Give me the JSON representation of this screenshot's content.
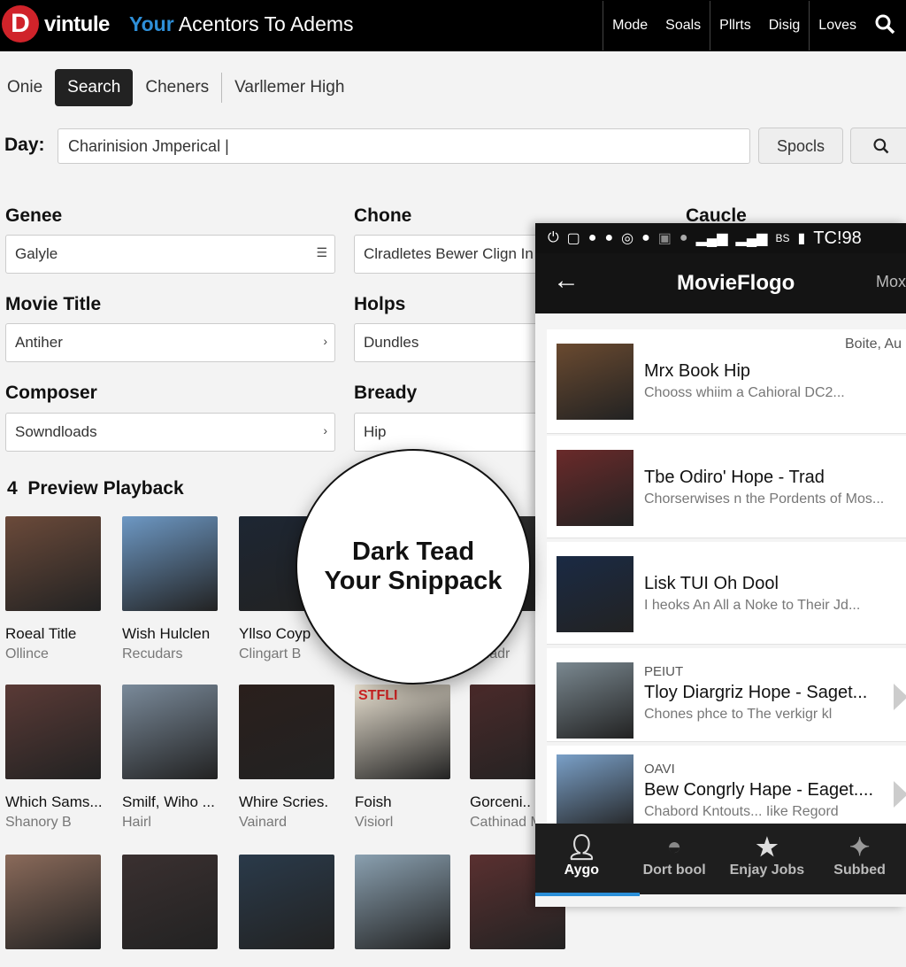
{
  "header": {
    "logo_letter": "D",
    "brand": "vintule",
    "tagline_accent": "Your",
    "tagline": "Acentors To Adems",
    "nav": [
      "Mode",
      "Soals",
      "Pllrts",
      "Disig",
      "Loves"
    ],
    "search_icon": "search-icon"
  },
  "tabs": [
    {
      "label": "Onie"
    },
    {
      "label": "Search",
      "active": true
    },
    {
      "label": "Cheners"
    },
    {
      "label": "Varllemer High"
    }
  ],
  "day": {
    "label": "Day:",
    "value": "Charinision Jmperical |",
    "button": "Spocls"
  },
  "form": {
    "genre": {
      "label": "Genee",
      "value": "Galyle"
    },
    "chone": {
      "label": "Chone",
      "value": "Clradletes Bewer Clign In"
    },
    "cauclе": {
      "label": "Caucle"
    },
    "movie_title": {
      "label": "Movie Title",
      "value": "Antiher"
    },
    "holps": {
      "label": "Holps",
      "value": "Dundles"
    },
    "composer": {
      "label": "Composer",
      "value": "Sowndloads"
    },
    "bready": {
      "label": "Bready",
      "value": "Hip"
    }
  },
  "section": {
    "count": "4",
    "title": "Preview Playback"
  },
  "grid": [
    {
      "title": "Roeal Title",
      "sub": "Ollince",
      "color": "#6b4a3a"
    },
    {
      "title": "Wish Hulclen",
      "sub": "Recudars",
      "color": "#6d98c4"
    },
    {
      "title": "Yllso Coyp",
      "sub": "Clingart B",
      "color": "#1d2633"
    },
    {
      "title": "",
      "sub": "",
      "color": "#444"
    },
    {
      "title": "...tin",
      "sub": "...riadr",
      "color": "#333"
    },
    {
      "title": "Which Sams...",
      "sub": "Shanory B",
      "color": "#5a3a36"
    },
    {
      "title": "Smilf, Wiho ...",
      "sub": "Hairl",
      "color": "#7a8a9a"
    },
    {
      "title": "Whire Scries.",
      "sub": "Vainard",
      "color": "#2a1f1c"
    },
    {
      "title": "Foish",
      "sub": "Visiorl",
      "color": "#e8e0d0",
      "poster_text": "STFLI"
    },
    {
      "title": "Gorceni..",
      "sub": "Cathinad M",
      "color": "#4a2a2a"
    },
    {
      "title": "",
      "sub": "",
      "color": "#8a6a5a"
    },
    {
      "title": "",
      "sub": "",
      "color": "#3a3030"
    },
    {
      "title": "",
      "sub": "",
      "color": "#2a3a4a"
    },
    {
      "title": "",
      "sub": "",
      "color": "#8aa0b0"
    },
    {
      "title": "",
      "sub": "",
      "color": "#5a3030"
    }
  ],
  "overlay": {
    "line1": "Dark Tead",
    "line2": "Your Snippack"
  },
  "phone": {
    "status": {
      "icons": [
        "power-icon",
        "square-icon",
        "message-icon",
        "chat-icon",
        "sync-icon",
        "location-icon",
        "image-icon",
        "apple-icon",
        "signal-icon",
        "signal-icon"
      ],
      "network": "BS",
      "time": "TC!98"
    },
    "title": "MovieFlogo",
    "more": "Mox",
    "items": [
      {
        "kicker": "",
        "title": "Mrx Book Hip",
        "desc": "Chooss whiim a Cahioral DC2...",
        "meta": "Boite, Au",
        "color": "#6a4a30"
      },
      {
        "kicker": "",
        "title": "Tbe Odiro' Hope - Trad",
        "desc": "Chorserwises n the Pordents of Mos...",
        "color": "#6a2a2a"
      },
      {
        "kicker": "",
        "title": "Lisk TUI Oh Dool",
        "desc": "I heoks An All a Noke to Their Jd...",
        "color": "#1a2a44"
      },
      {
        "kicker": "PEIUT",
        "title": "Tloy Diargriz Hope - Saget...",
        "desc": "Chones phce to The verkigr kl",
        "color": "#7a8890"
      },
      {
        "kicker": "OAVI",
        "title": "Bew Congrly Hape - Eaget....",
        "desc": "Chabord Kntouts... Iike Regord",
        "color": "#7aa0c8"
      }
    ],
    "bottom_nav": [
      {
        "label": "Aygo",
        "icon": "person-icon",
        "active": true
      },
      {
        "label": "Dort bool",
        "icon": "arch-icon"
      },
      {
        "label": "Enjay Jobs",
        "icon": "star-icon"
      },
      {
        "label": "Subbed",
        "icon": "sparkle-icon"
      }
    ]
  }
}
